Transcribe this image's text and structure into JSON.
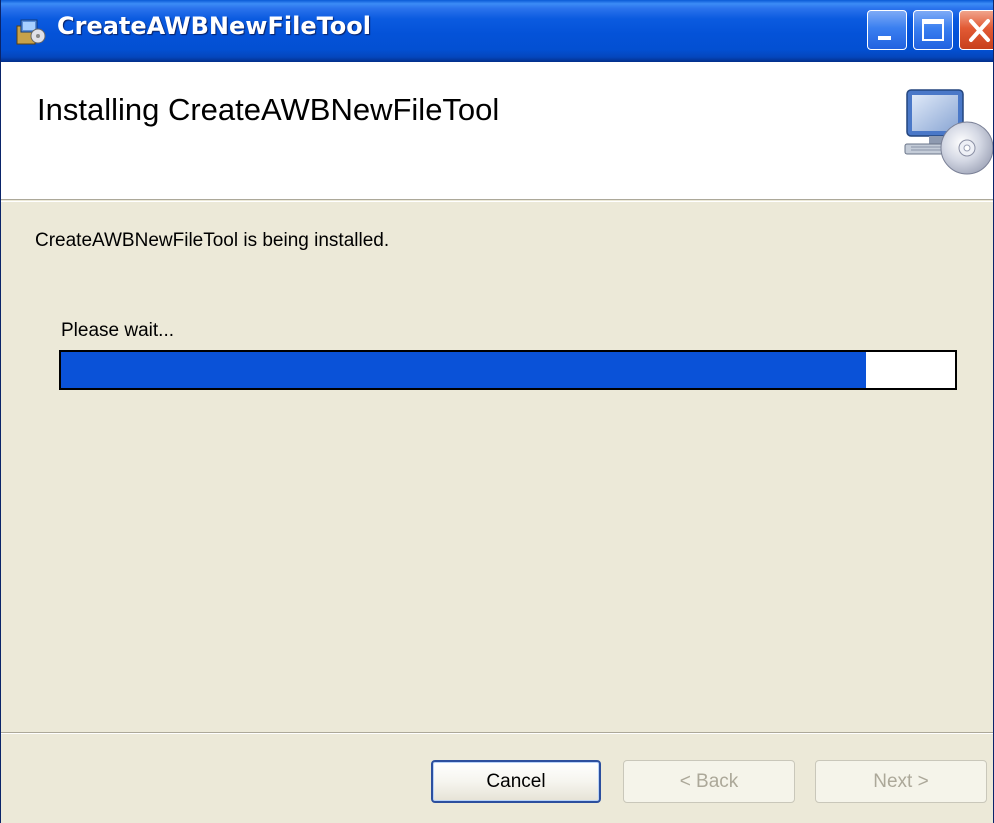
{
  "window": {
    "title": "CreateAWBNewFileTool"
  },
  "banner": {
    "title": "Installing CreateAWBNewFileTool",
    "icon": "computer-with-cd-icon"
  },
  "body": {
    "status_text": "CreateAWBNewFileTool is being installed.",
    "wait_text": "Please wait...",
    "progress_fraction": 0.9
  },
  "buttons": {
    "cancel_label": "Cancel",
    "back_label": "< Back",
    "next_label": "Next >"
  },
  "colors": {
    "titlebar": "#0452d8",
    "progress_fill": "#0a52d8",
    "dialog_bg": "#ece9d8"
  }
}
